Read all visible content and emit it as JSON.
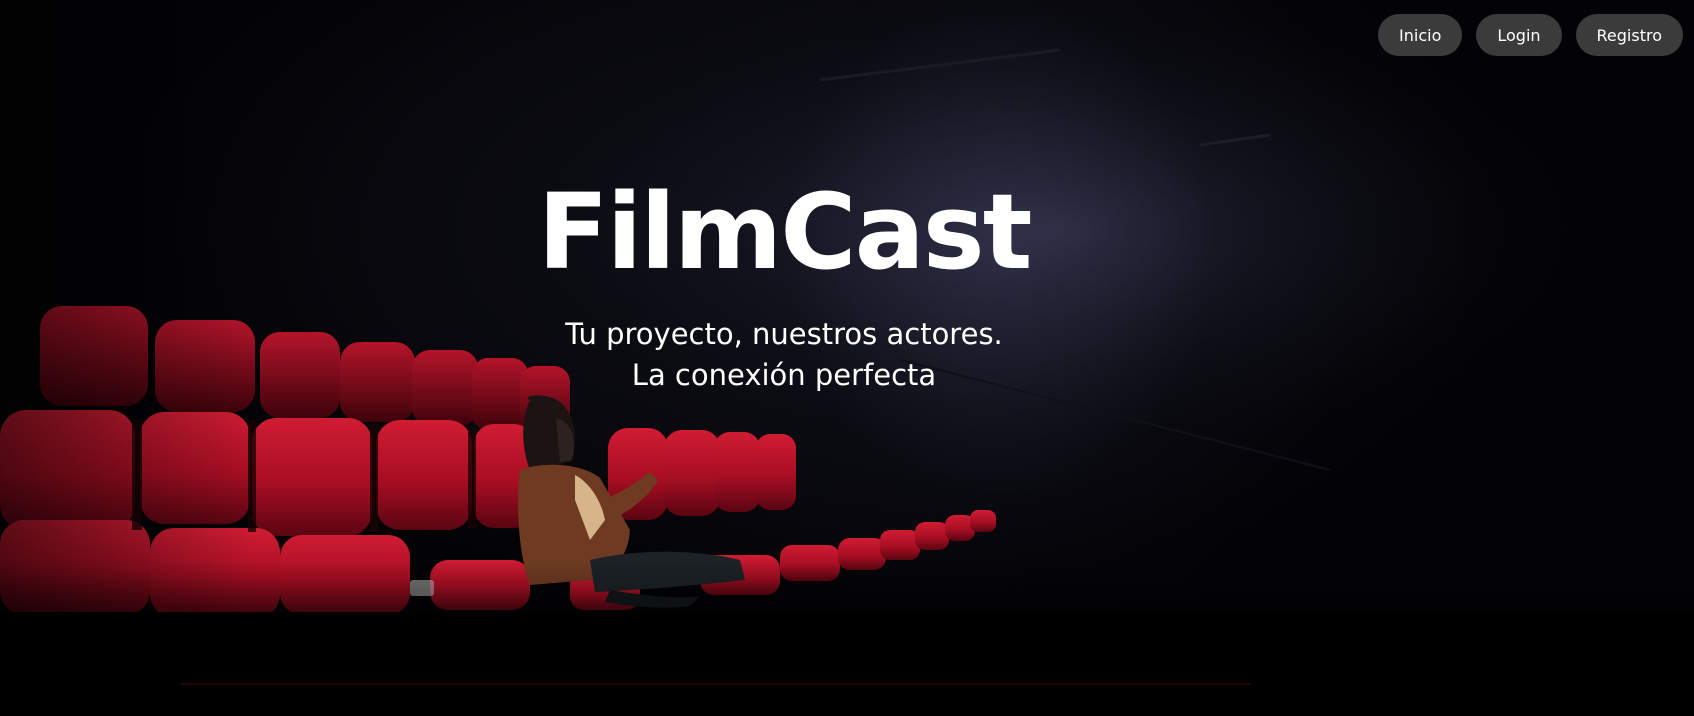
{
  "nav": {
    "items": [
      {
        "label": "Inicio"
      },
      {
        "label": "Login"
      },
      {
        "label": "Registro"
      }
    ]
  },
  "hero": {
    "title": "FilmCast",
    "subtitle_line1": "Tu proyecto, nuestros actores.",
    "subtitle_line2": "La conexión perfecta"
  },
  "colors": {
    "nav_button_bg": "#3b3b3b",
    "seat_red": "#c0142a",
    "background": "#030306"
  }
}
